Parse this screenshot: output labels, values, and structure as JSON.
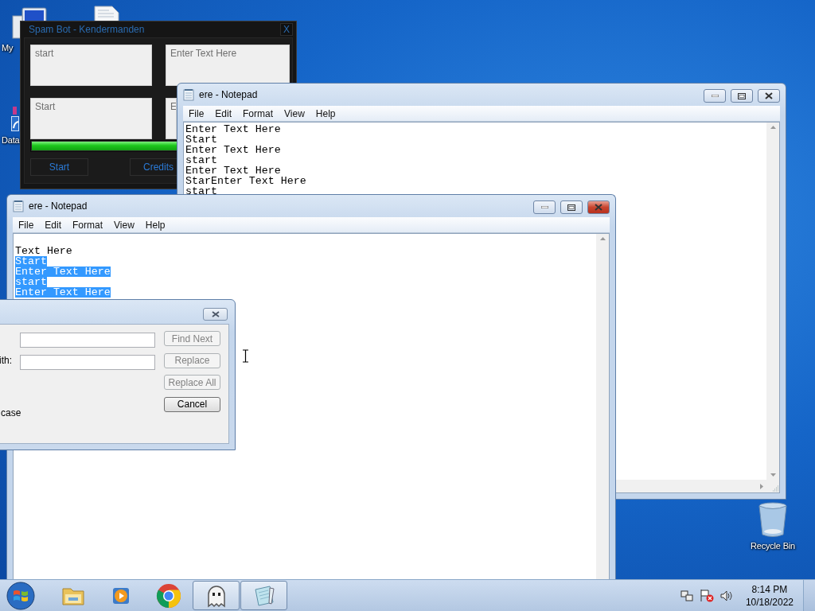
{
  "desktop_icons": [
    {
      "kind": "computer",
      "label": "My"
    },
    {
      "kind": "document"
    },
    {
      "kind": "shortcut",
      "label": "Data"
    },
    {
      "kind": "recycle_bin",
      "label": "Recycle Bin"
    }
  ],
  "spam_bot": {
    "title": "Spam Bot - Kendermanden",
    "close": "X",
    "text_boxes": [
      "start",
      "Enter Text Here",
      "Start",
      "E"
    ],
    "progress": {
      "level": 1
    },
    "buttons": [
      "Start",
      "Credits"
    ]
  },
  "notepad_back": {
    "title": "ere - Notepad",
    "focused": false,
    "menu": [
      "File",
      "Edit",
      "Format",
      "View",
      "Help"
    ],
    "lines": [
      {
        "text": "Enter Text Here",
        "selected": false
      },
      {
        "text": "Start",
        "selected": false
      },
      {
        "text": "Enter Text Here",
        "selected": false
      },
      {
        "text": "start",
        "selected": false
      },
      {
        "text": "Enter Text Here",
        "selected": false
      },
      {
        "text": "StarEnter Text Here",
        "selected": false
      },
      {
        "text": "start",
        "selected": false
      }
    ]
  },
  "notepad_front": {
    "title": "ere - Notepad",
    "focused": true,
    "menu": [
      "File",
      "Edit",
      "Format",
      "View",
      "Help"
    ],
    "lines": [
      {
        "text": "Text Here",
        "selected": false
      },
      {
        "text": "Start",
        "selected": true
      },
      {
        "text": "Enter Text Here",
        "selected": true
      },
      {
        "text": "start",
        "selected": true
      },
      {
        "text": "Enter Text Here",
        "selected": true
      }
    ]
  },
  "replace_dialog": {
    "replace_label": "ith:",
    "match_case_label": "case",
    "buttons": [
      {
        "label": "Find Next",
        "disabled": true
      },
      {
        "label": "Replace",
        "disabled": true
      },
      {
        "label": "Replace All",
        "disabled": true
      },
      {
        "label": "Cancel",
        "disabled": false
      }
    ]
  },
  "taskbar": {
    "apps": [
      {
        "kind": "folder",
        "active": false
      },
      {
        "kind": "media",
        "active": false
      },
      {
        "kind": "chrome",
        "active": false
      },
      {
        "kind": "ghost",
        "active": true
      },
      {
        "kind": "notepad",
        "active": true
      }
    ],
    "clock": {
      "time": "8:14 PM",
      "date": "10/18/2022"
    }
  }
}
